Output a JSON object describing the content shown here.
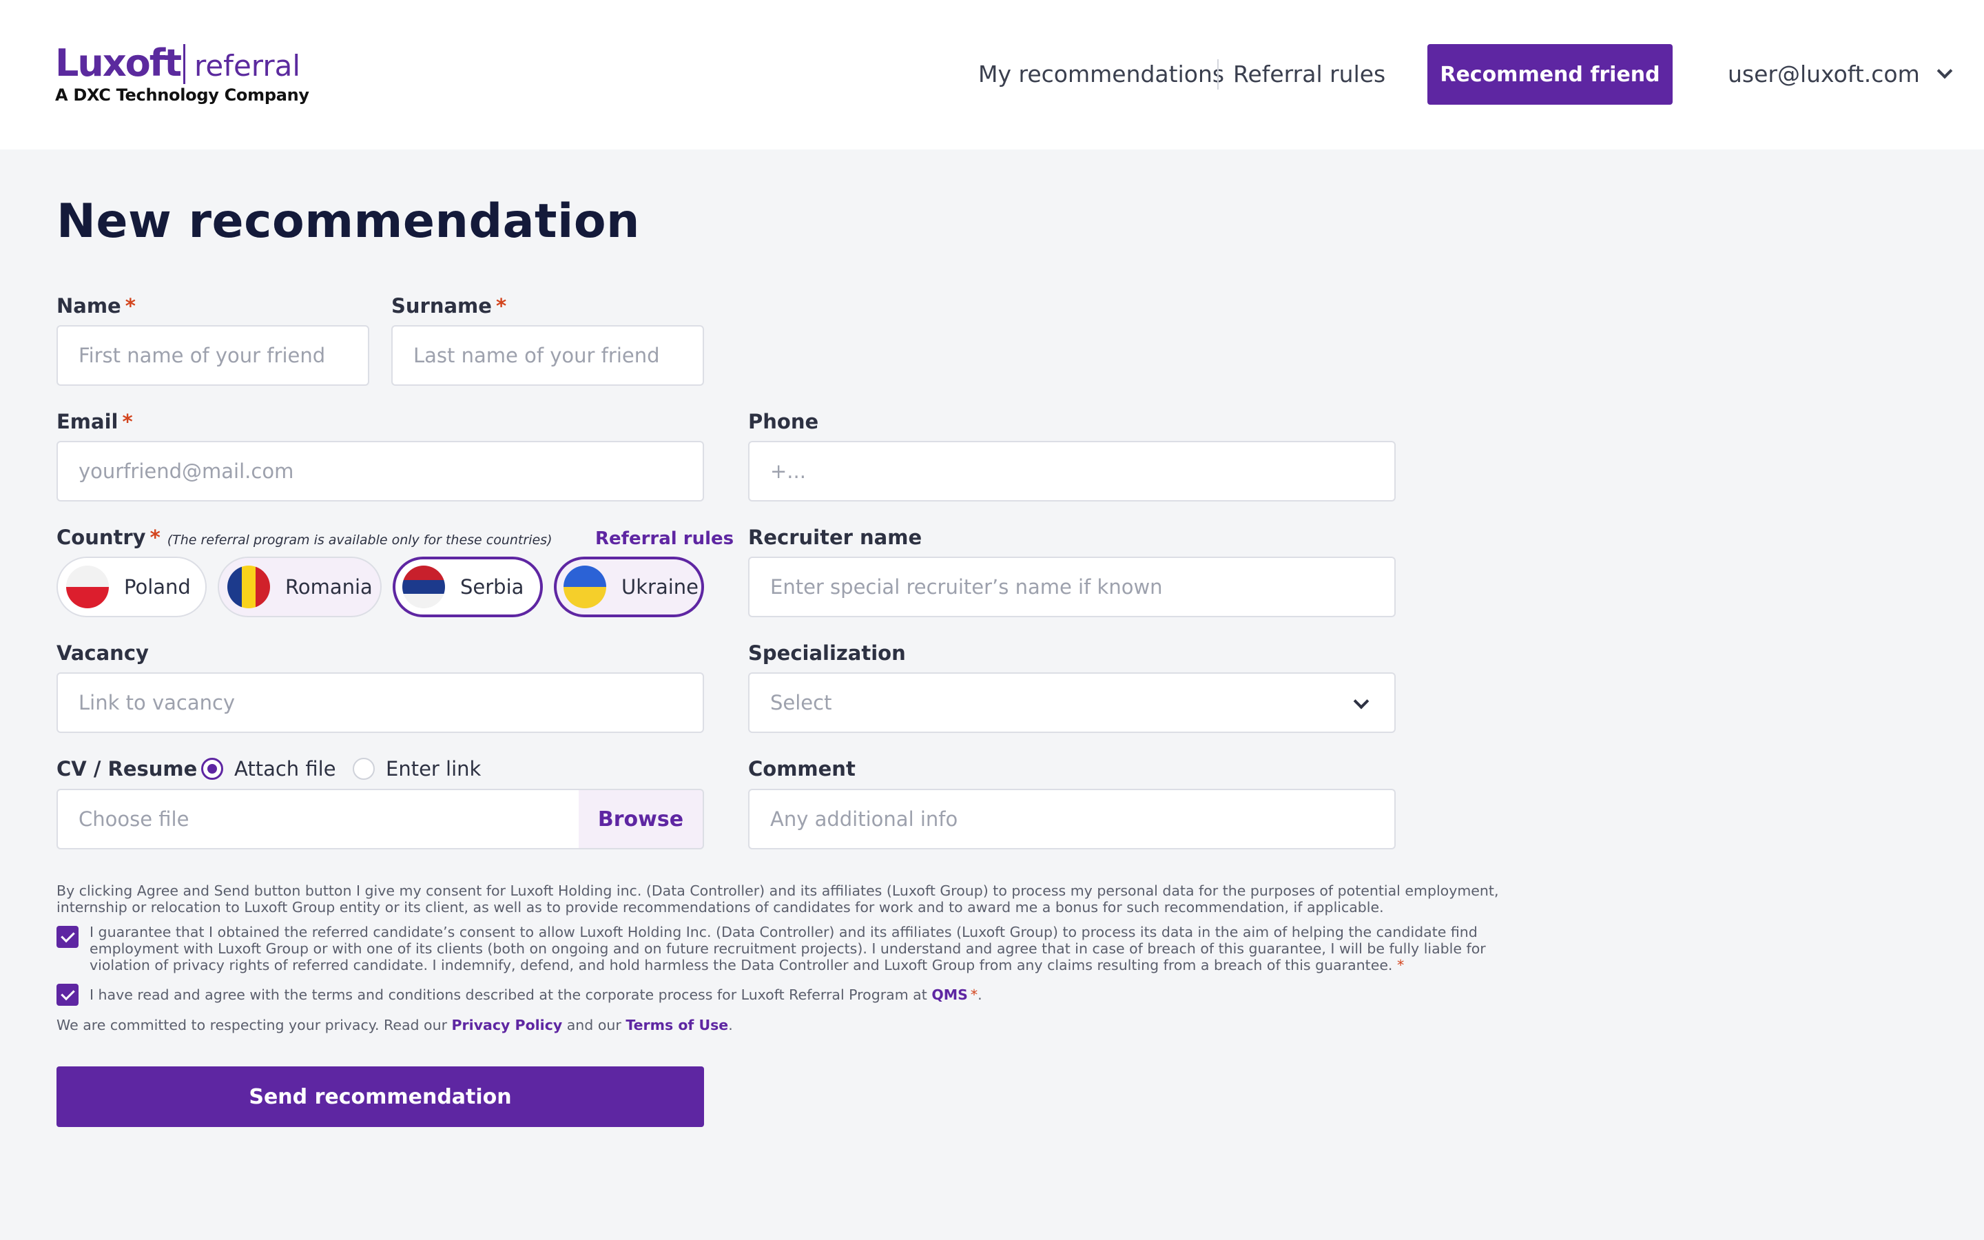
{
  "header": {
    "logo_main": "Luxoft",
    "logo_sub": "referral",
    "logo_tagline": "A DXC Technology Company",
    "nav": {
      "my_recommendations": "My recommendations",
      "referral_rules": "Referral rules"
    },
    "recommend_button": "Recommend friend",
    "user_email": "user@luxoft.com"
  },
  "page": {
    "title": "New recommendation"
  },
  "form": {
    "name": {
      "label": "Name",
      "required": "*",
      "placeholder": "First name of your friend"
    },
    "surname": {
      "label": "Surname",
      "required": "*",
      "placeholder": "Last name of your friend"
    },
    "email": {
      "label": "Email",
      "required": "*",
      "placeholder": "yourfriend@mail.com"
    },
    "phone": {
      "label": "Phone",
      "placeholder": "+..."
    },
    "country": {
      "label": "Country",
      "required": "*",
      "note": "(The referral program is available only for these countries)",
      "rules_link": "Referral rules",
      "options": [
        {
          "label": "Poland",
          "selected": false
        },
        {
          "label": "Romania",
          "selected": false
        },
        {
          "label": "Serbia",
          "selected": true
        },
        {
          "label": "Ukraine",
          "selected": true
        }
      ]
    },
    "recruiter": {
      "label": "Recruiter name",
      "placeholder": "Enter special recruiter’s name if known"
    },
    "vacancy": {
      "label": "Vacancy",
      "placeholder": "Link to vacancy"
    },
    "specialization": {
      "label": "Specialization",
      "value": "Select"
    },
    "cv": {
      "label": "CV / Resume",
      "option_attach": "Attach file",
      "option_link": "Enter link",
      "selected": "attach",
      "placeholder": "Choose file",
      "browse": "Browse"
    },
    "comment": {
      "label": "Comment",
      "placeholder": "Any additional info"
    }
  },
  "consent": {
    "intro_line1": "By clicking Agree and Send button button I give my consent for Luxoft Holding inc. (Data Controller) and its affiliates (Luxoft Group) to process my personal data for the purposes of potential employment,",
    "intro_line2": "internship or relocation to Luxoft Group entity or its client, as well as to provide recommendations of candidates for work and to award me a bonus for such recommendation, if applicable.",
    "guarantee_line1": "I guarantee that I obtained the referred candidate’s consent to allow Luxoft Holding Inc. (Data Controller) and its affiliates (Luxoft Group) to process its data in the aim of helping the candidate find",
    "guarantee_line2": "employment with Luxoft Group or with one of its clients (both on ongoing and on future recruitment projects). I understand and agree that in case of breach of this guarantee, I will be fully liable for",
    "guarantee_line3": "violation of privacy rights of referred candidate. I indemnify, defend, and hold harmless the Data Controller and Luxoft Group from any claims resulting from a breach of this guarantee.",
    "guarantee_required": "*",
    "guarantee_checked": true,
    "terms_text": "I have read and agree with the terms and conditions described at the corporate process for Luxoft Referral Program at",
    "terms_link": "QMS",
    "terms_required": "*",
    "terms_end": ".",
    "terms_checked": true,
    "privacy_text": "We are committed to respecting your privacy. Read our",
    "privacy_link": "Privacy Policy",
    "privacy_and": "and our",
    "terms_of_use_link": "Terms of Use",
    "privacy_end": "."
  },
  "submit_button": "Send recommendation",
  "colors": {
    "accent": "#5e26a2",
    "required": "#d3451e",
    "background": "#f4f5f7"
  }
}
